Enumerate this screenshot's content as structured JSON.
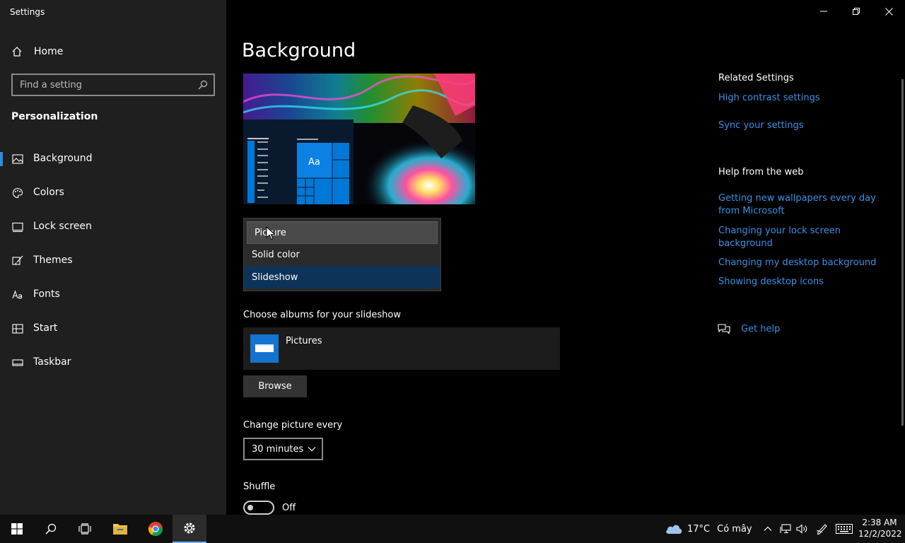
{
  "window": {
    "title": "Settings"
  },
  "sidebar": {
    "home_label": "Home",
    "search_placeholder": "Find a setting",
    "section_title": "Personalization",
    "items": [
      {
        "label": "Background",
        "icon": "picture-icon"
      },
      {
        "label": "Colors",
        "icon": "palette-icon"
      },
      {
        "label": "Lock screen",
        "icon": "lock-screen-icon"
      },
      {
        "label": "Themes",
        "icon": "brush-icon"
      },
      {
        "label": "Fonts",
        "icon": "font-icon"
      },
      {
        "label": "Start",
        "icon": "start-icon"
      },
      {
        "label": "Taskbar",
        "icon": "taskbar-icon"
      }
    ],
    "active_index": 0
  },
  "main": {
    "page_title": "Background",
    "preview_tile_label": "Aa",
    "background_dropdown": {
      "options": [
        "Picture",
        "Solid color",
        "Slideshow"
      ],
      "selected": "Slideshow",
      "hovered": "Picture"
    },
    "albums_label": "Choose albums for your slideshow",
    "album_name": "Pictures",
    "browse_label": "Browse",
    "change_every_label": "Change picture every",
    "change_every_value": "30 minutes",
    "shuffle_label": "Shuffle",
    "shuffle_state": "Off"
  },
  "related": {
    "heading": "Related Settings",
    "links": [
      "High contrast settings",
      "Sync your settings"
    ]
  },
  "help": {
    "heading": "Help from the web",
    "links": [
      "Getting new wallpapers every day from Microsoft",
      "Changing your lock screen background",
      "Changing my desktop background",
      "Showing desktop icons"
    ],
    "get_help": "Get help"
  },
  "taskbar": {
    "weather_temp": "17°C",
    "weather_desc": "Có mây",
    "time": "2:38 AM",
    "date": "12/2/2022"
  },
  "colors": {
    "accent": "#0078d7",
    "link": "#3a91e6",
    "sidebar_bg": "#1f1f1f",
    "dropdown_selected": "#0d3358"
  }
}
